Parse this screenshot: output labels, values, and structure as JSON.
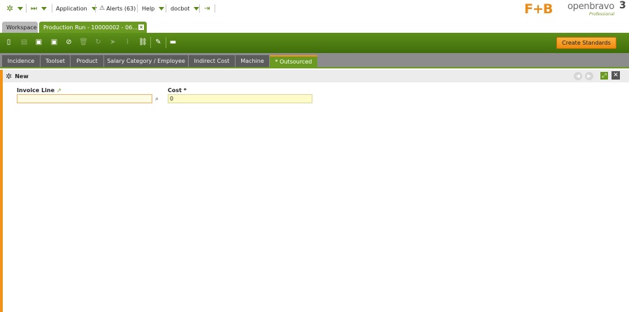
{
  "nav": {
    "application": "Application",
    "alerts": "Alerts (63)",
    "help": "Help",
    "user": "docbot"
  },
  "branding": {
    "client_logo": "F+B",
    "product_name": "openbravo",
    "product_version": "3",
    "product_edition": "Professional"
  },
  "window_tabs": {
    "workspace": "Workspace",
    "active": "Production Run - 10000002 - 06..."
  },
  "toolbar": {
    "create_standards": "Create Standards"
  },
  "sub_tabs": [
    {
      "label": "Incidence"
    },
    {
      "label": "Toolset"
    },
    {
      "label": "Product"
    },
    {
      "label": "Salary Category / Employee"
    },
    {
      "label": "Indirect Cost"
    },
    {
      "label": "Machine"
    },
    {
      "label": "* Outsourced",
      "active": true
    }
  ],
  "form": {
    "status": "New",
    "invoice_line_label": "Invoice Line",
    "invoice_line_value": "",
    "cost_label": "Cost *",
    "cost_value": "0"
  },
  "colors": {
    "brand_green": "#6b9a22",
    "accent_orange": "#f29318"
  }
}
